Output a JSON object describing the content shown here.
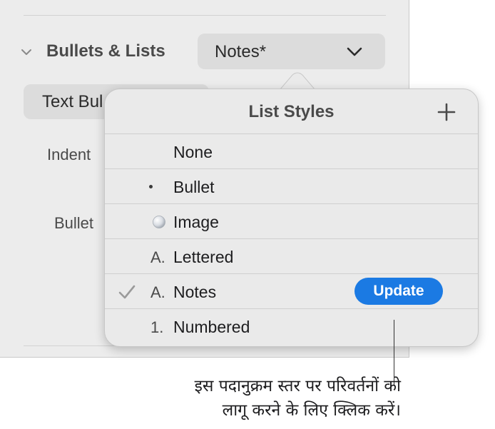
{
  "sidebar": {
    "section_title": "Bullets & Lists",
    "style_popup_value": "Notes*",
    "text_bullets_label": "Text Bul",
    "indent_label": "Indent",
    "bullet_label": "Bullet"
  },
  "popover": {
    "title": "List Styles",
    "add_icon": "plus-icon",
    "items": [
      {
        "label": "None",
        "marker": "",
        "selected": false
      },
      {
        "label": "Bullet",
        "marker": "•",
        "selected": false
      },
      {
        "label": "Image",
        "marker": "image-bullet-icon",
        "selected": false
      },
      {
        "label": "Lettered",
        "marker": "A.",
        "selected": false
      },
      {
        "label": "Notes",
        "marker": "A.",
        "selected": true
      },
      {
        "label": "Numbered",
        "marker": "1.",
        "selected": false
      }
    ],
    "update_label": "Update",
    "accent_color": "#1b7ae3"
  },
  "callout": {
    "line1": "इस पदानुक्रम स्तर पर परिवर्तनों को",
    "line2": "लागू करने के लिए क्लिक करें।"
  }
}
